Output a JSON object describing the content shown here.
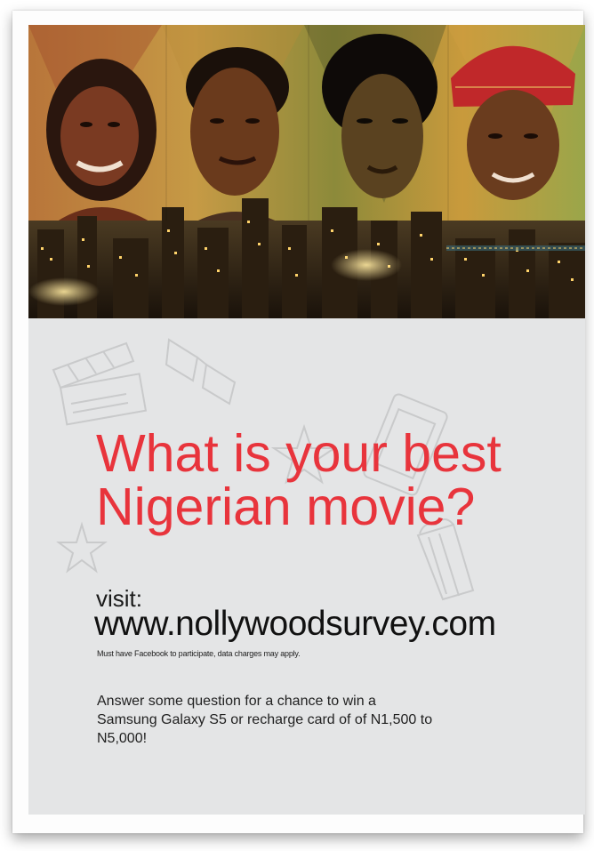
{
  "headline": "What is your best Nigerian movie?",
  "visit_label": "visit:",
  "url": "www.nollywoodsurvey.com",
  "disclaimer": "Must have Facebook to participate, data charges may apply.",
  "prize_text": "Answer some question for a chance to win a Samsung Galaxy S5 or recharge card of of N1,500 to N5,000!",
  "colors": {
    "headline": "#e8343c",
    "panel": "#e4e5e6",
    "text": "#222222"
  },
  "decorations": [
    "clapperboard-icon",
    "3d-glasses-icon",
    "star-icon",
    "ticket-phone-icon",
    "popcorn-icon"
  ]
}
